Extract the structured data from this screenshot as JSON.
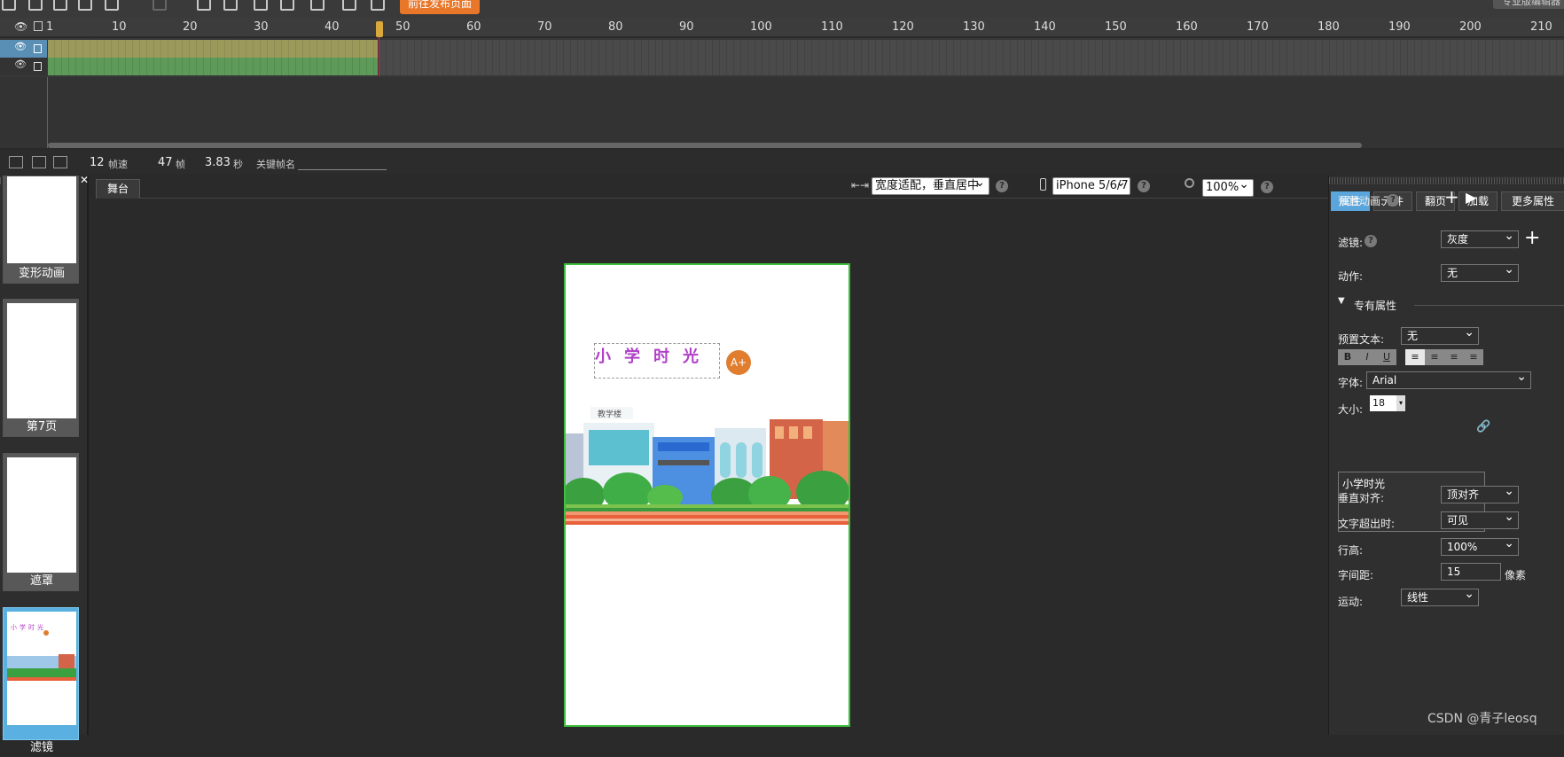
{
  "toolbar": {
    "publish_label": "前往发布页面",
    "pro_label": "专业版编辑器"
  },
  "ruler": {
    "ticks": [
      "1",
      "10",
      "20",
      "30",
      "40",
      "50",
      "60",
      "70",
      "80",
      "90",
      "100",
      "110",
      "120",
      "130",
      "140",
      "150",
      "160",
      "170",
      "180",
      "190",
      "200",
      "210"
    ]
  },
  "status": {
    "fps_value": "12",
    "fps_unit": "帧速",
    "frame_value": "47",
    "frame_unit": "帧",
    "time_value": "3.83",
    "time_unit": "秒",
    "keyframe_label": "关键帧名"
  },
  "pages": [
    {
      "label": "变形动画"
    },
    {
      "label": "第7页"
    },
    {
      "label": "遮罩"
    },
    {
      "label": "滤镜"
    }
  ],
  "stage": {
    "tab_label": "舞台",
    "fit_mode": "宽度适配，垂直居中",
    "device": "iPhone 5/6/7",
    "zoom": "100%",
    "title_text": "小学时光",
    "building_sign": "教学楼",
    "a_plus": "A+"
  },
  "right_panel": {
    "tabs": [
      "属性",
      "元件",
      "翻页",
      "加载",
      "更多属性"
    ],
    "preset_anim_label": "预置动画:",
    "filter_label": "滤镜:",
    "filter_value": "灰度",
    "action_label": "动作:",
    "action_value": "无",
    "special_section": "专有属性",
    "preset_text_label": "预置文本:",
    "preset_text_value": "无",
    "font_label": "字体:",
    "font_value": "Arial",
    "size_label": "大小:",
    "size_value": "18",
    "text_content": "小学时光",
    "valign_label": "垂直对齐:",
    "valign_value": "顶对齐",
    "overflow_label": "文字超出时:",
    "overflow_value": "可见",
    "line_height_label": "行高:",
    "line_height_value": "100%",
    "letter_spacing_label": "字间距:",
    "letter_spacing_value": "15",
    "letter_spacing_unit": "像素",
    "motion_label": "运动:",
    "motion_value": "线性"
  },
  "watermark": "CSDN @青子leosq",
  "colors": {
    "accent": "#e8772a",
    "stage_border": "#3dbf3d",
    "title_text": "#b03fc8",
    "active_tab": "#5aa6dc"
  }
}
